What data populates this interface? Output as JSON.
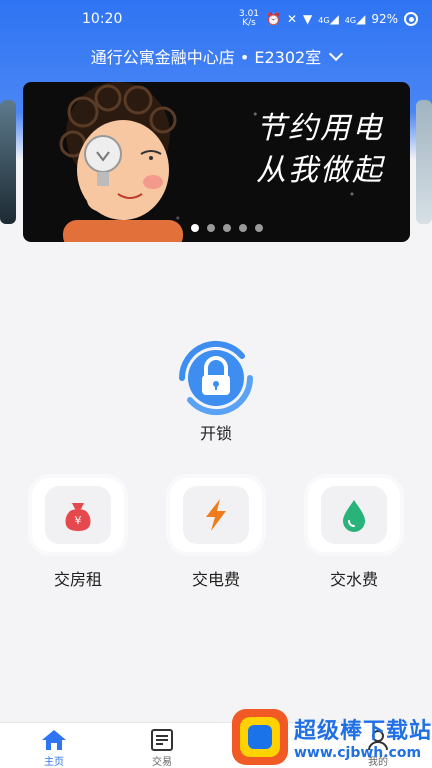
{
  "status_bar": {
    "time": "10:20",
    "speed": "3.01 K/s",
    "network1": "4G",
    "network2": "4G",
    "battery": "92%"
  },
  "header": {
    "location": "通行公寓金融中心店 • E2302室"
  },
  "banner": {
    "title_line1": "节约用电",
    "title_line2": "从我做起",
    "dot_count": 5,
    "active_dot": 0
  },
  "unlock": {
    "label": "开锁",
    "icon": "lock-icon",
    "color": "#3d8ef0"
  },
  "actions": [
    {
      "label": "交房租",
      "icon": "money-bag-icon",
      "color": "#e5484d"
    },
    {
      "label": "交电费",
      "icon": "lightning-icon",
      "color": "#f07b1a"
    },
    {
      "label": "交水费",
      "icon": "water-drop-icon",
      "color": "#2ab27b"
    }
  ],
  "tabbar": [
    {
      "label": "主页",
      "icon": "home-icon",
      "active": true
    },
    {
      "label": "交易",
      "icon": "document-icon",
      "active": false
    },
    {
      "label": "",
      "icon": "",
      "active": false
    },
    {
      "label": "我的",
      "icon": "user-icon",
      "active": false
    }
  ],
  "watermark": {
    "title": "超级棒下载站",
    "url": "www.cjbwh.com"
  },
  "colors": {
    "primary": "#2f74f3",
    "background": "#f4f4f6"
  }
}
